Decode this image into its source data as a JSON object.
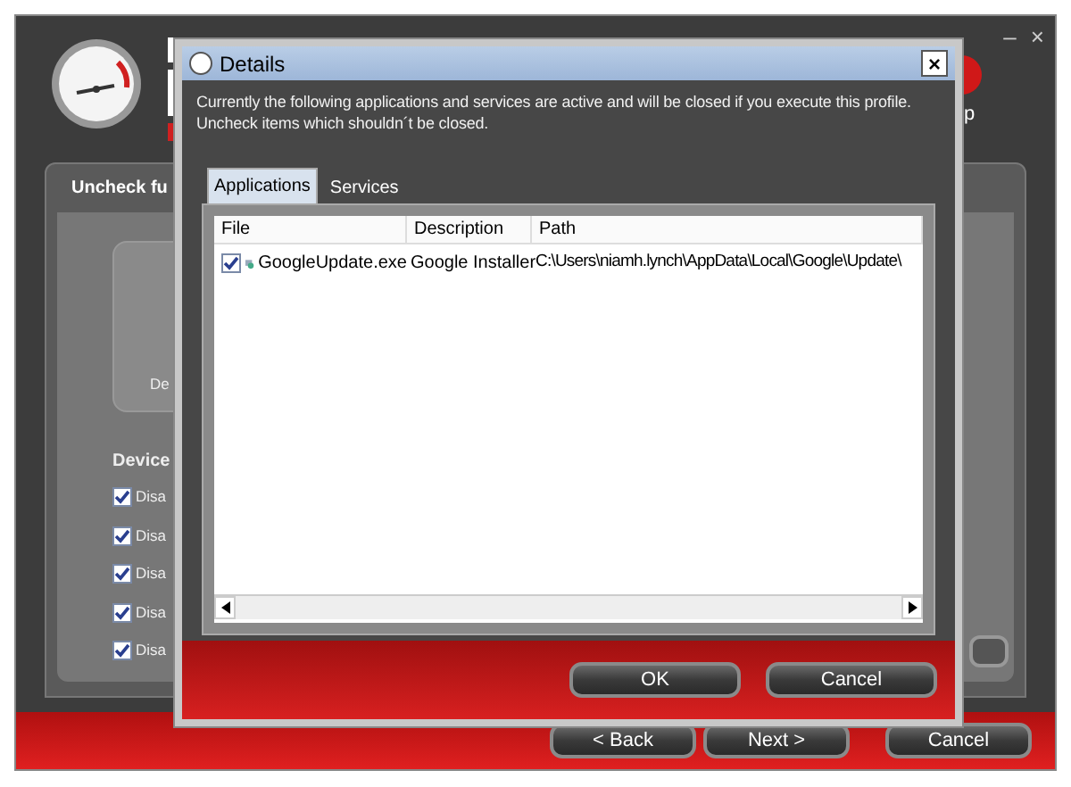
{
  "app": {
    "window_controls": [
      "–",
      "×"
    ],
    "header_link": "p",
    "panel_title": "Uncheck fu",
    "card_label": "De",
    "section_label": "Device",
    "options": [
      {
        "label": "Disa",
        "checked": true
      },
      {
        "label": "Disa",
        "checked": true
      },
      {
        "label": "Disa",
        "checked": true
      },
      {
        "label": "Disa",
        "checked": true
      },
      {
        "label": "Disa",
        "checked": true
      }
    ],
    "buttons": [
      "< Back",
      "Next >",
      "Cancel"
    ]
  },
  "dialog": {
    "title": "Details",
    "close": "×",
    "message": "Currently the following applications and services are active and will be closed if you execute this profile.\nUncheck items which shouldn´t be closed.",
    "tabs": [
      {
        "label": "Applications",
        "selected": true
      },
      {
        "label": "Services",
        "selected": false
      }
    ],
    "table": {
      "columns": [
        "File",
        "Description",
        "Path"
      ],
      "rows": [
        {
          "checked": true,
          "file": "GoogleUpdate.exe",
          "description": "Google Installer",
          "path": "C:\\Users\\niamh.lynch\\AppData\\Local\\Google\\Update\\"
        }
      ]
    },
    "buttons": [
      "OK",
      "Cancel"
    ]
  }
}
